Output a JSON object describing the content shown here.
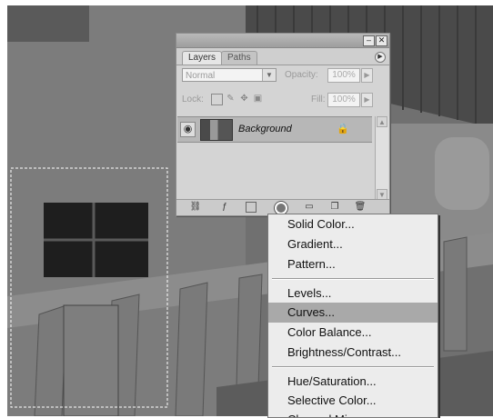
{
  "panel": {
    "tabs": [
      "Layers",
      "Paths"
    ],
    "blend_mode": "Normal",
    "opacity_label": "Opacity:",
    "opacity_value": "100%",
    "lock_label": "Lock:",
    "fill_label": "Fill:",
    "fill_value": "100%",
    "layers": [
      {
        "name": "Background",
        "visible": true,
        "locked": true
      }
    ],
    "icons": [
      "link-layers-icon",
      "layer-style-icon",
      "layer-mask-icon",
      "adjustment-layer-icon",
      "new-group-icon",
      "new-layer-icon",
      "trash-icon"
    ]
  },
  "menu": {
    "groups": [
      [
        "Solid Color...",
        "Gradient...",
        "Pattern..."
      ],
      [
        "Levels...",
        "Curves...",
        "Color Balance...",
        "Brightness/Contrast..."
      ],
      [
        "Hue/Saturation...",
        "Selective Color...",
        "Channel Mixer..."
      ]
    ],
    "highlighted": "Curves..."
  },
  "colors": {
    "photo": "#6b6b6b",
    "panel": "#d4d4d4",
    "highlight": "#a9a9a9"
  }
}
